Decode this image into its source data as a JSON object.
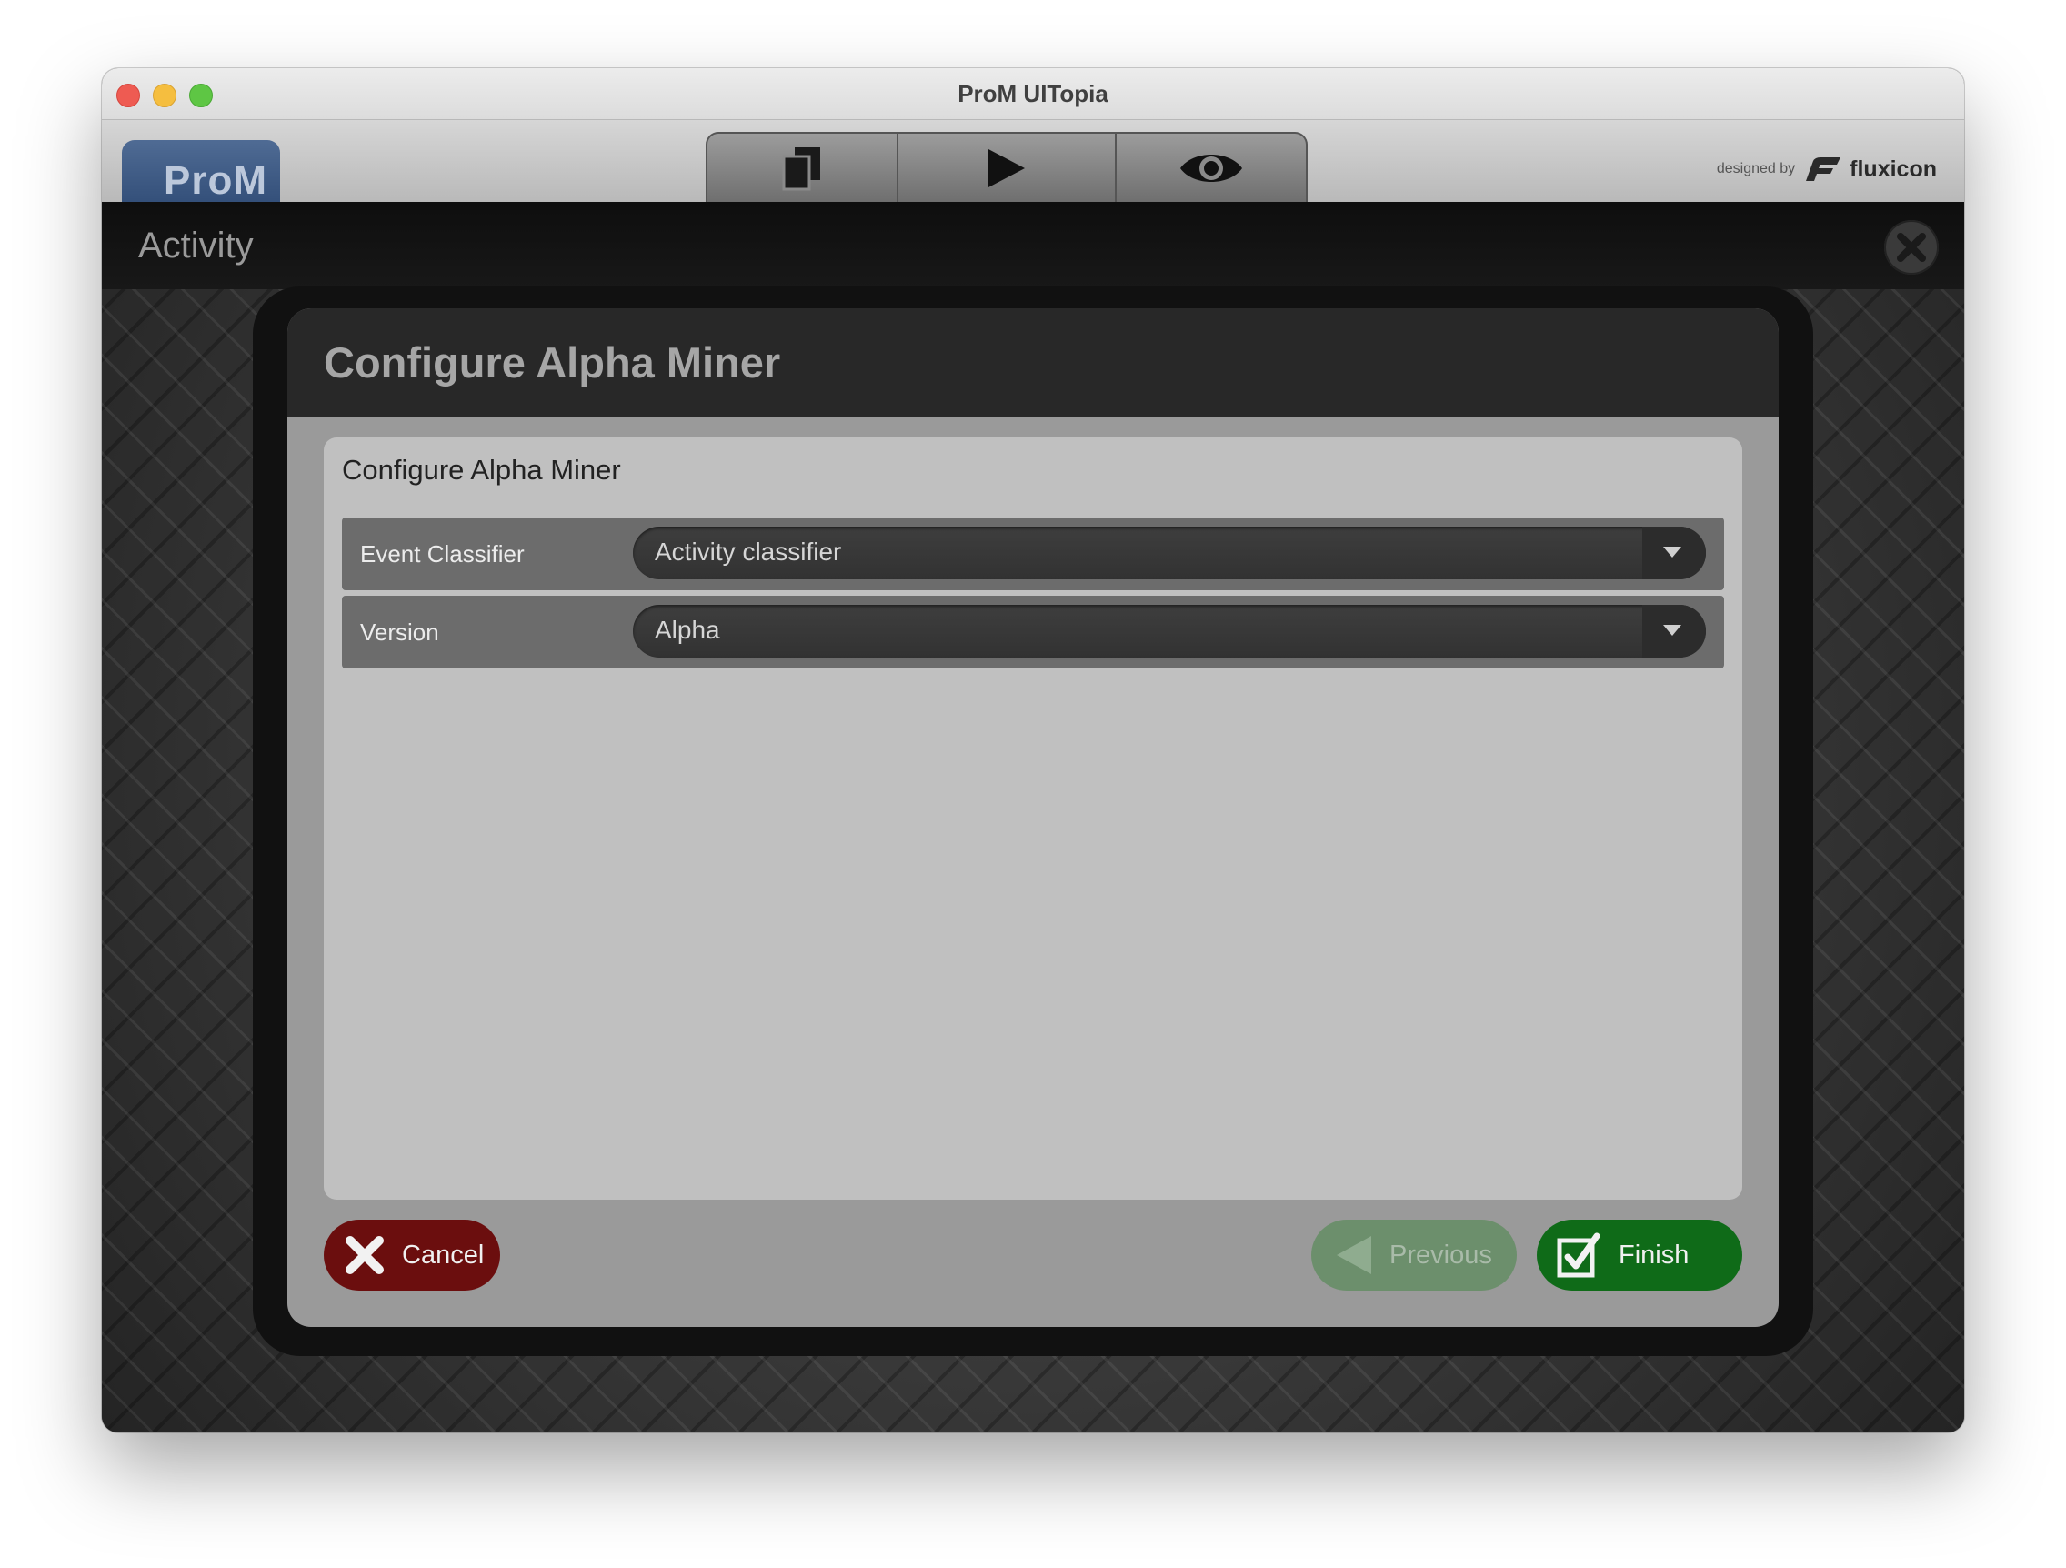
{
  "window": {
    "title": "ProM UITopia"
  },
  "toolbar": {
    "logo_text": "ProM",
    "tabs": [
      {
        "name": "workspace",
        "icon": "documents-icon"
      },
      {
        "name": "actions",
        "icon": "play-icon"
      },
      {
        "name": "views",
        "icon": "eye-icon"
      }
    ],
    "designed_by": "designed by",
    "brand": "fluxicon"
  },
  "activity": {
    "title": "Activity"
  },
  "dialog": {
    "title": "Configure Alpha Miner",
    "panel_title": "Configure Alpha Miner",
    "fields": [
      {
        "label": "Event Classifier",
        "value": "Activity classifier"
      },
      {
        "label": "Version",
        "value": "Alpha"
      }
    ],
    "buttons": {
      "cancel": "Cancel",
      "previous": "Previous",
      "finish": "Finish"
    }
  },
  "colors": {
    "cancel": "#6b0e0e",
    "previous_disabled": "#6c8f6c",
    "finish": "#0f6b18",
    "logo_blue": "#3f5c86"
  }
}
